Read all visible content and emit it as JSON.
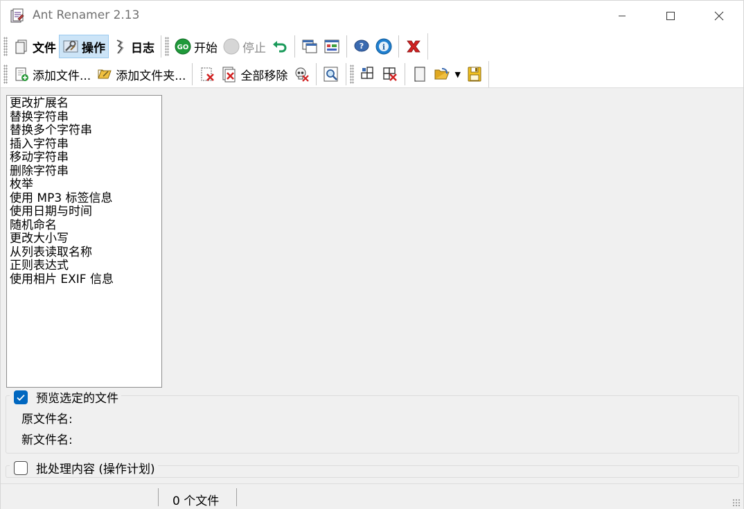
{
  "window": {
    "title": "Ant Renamer 2.13",
    "controls": {
      "minimize": "—",
      "maximize": "☐",
      "close": "✕"
    }
  },
  "toolbar1": {
    "file_label": "文件",
    "actions_label": "操作",
    "log_label": "日志",
    "start_label": "开始",
    "stop_label": "停止"
  },
  "toolbar2": {
    "add_files_label": "添加文件...",
    "add_folders_label": "添加文件夹...",
    "remove_all_label": "全部移除"
  },
  "actions_list": [
    "更改扩展名",
    "替换字符串",
    "替换多个字符串",
    "插入字符串",
    "移动字符串",
    "删除字符串",
    "枚举",
    "使用 MP3 标签信息",
    "使用日期与时间",
    "随机命名",
    "更改大小写",
    "从列表读取名称",
    "正则表达式",
    "使用相片 EXIF 信息"
  ],
  "preview": {
    "checkbox_label": "预览选定的文件",
    "checked": true,
    "original_name_label": "原文件名:",
    "new_name_label": "新文件名:"
  },
  "batch": {
    "checkbox_label": "批处理内容 (操作计划)",
    "checked": false
  },
  "status": {
    "file_count": "0 个文件"
  },
  "colors": {
    "accent": "#0067c0",
    "active_toolbar_bg": "#cce4f7",
    "window_bg": "#f0f0f0"
  }
}
